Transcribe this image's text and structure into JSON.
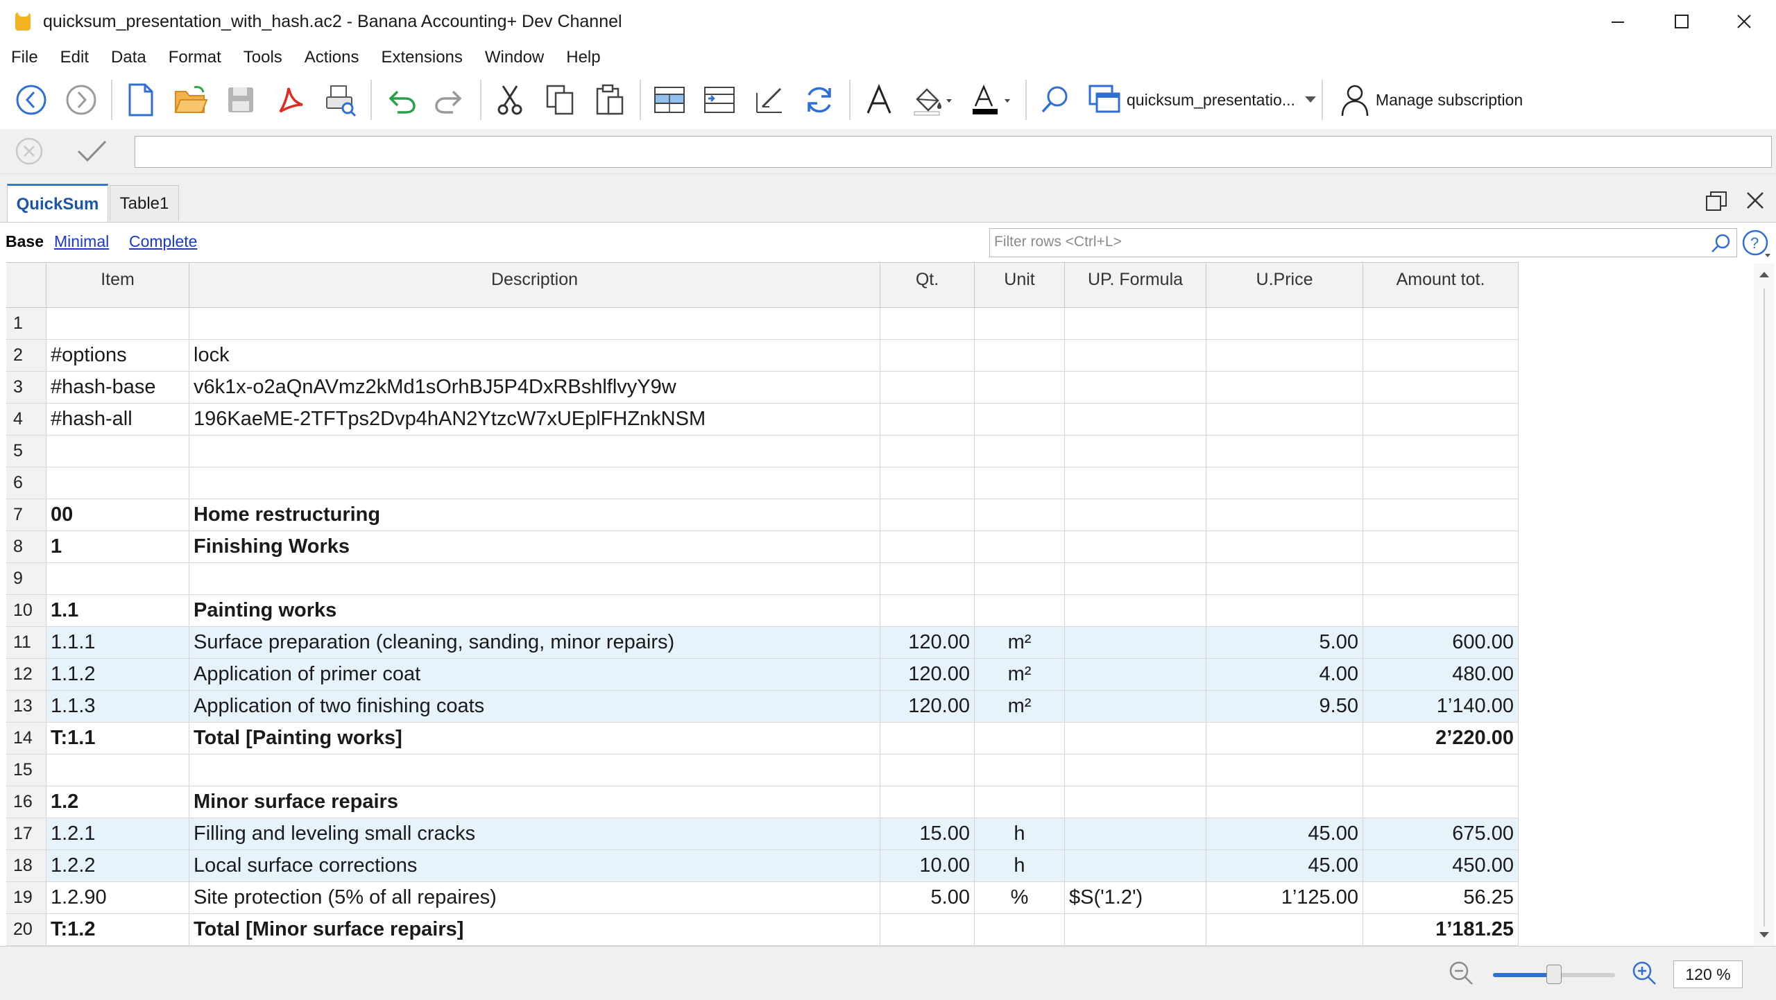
{
  "window": {
    "title": "quicksum_presentation_with_hash.ac2 - Banana Accounting+ Dev Channel"
  },
  "menu": [
    "File",
    "Edit",
    "Data",
    "Format",
    "Tools",
    "Actions",
    "Extensions",
    "Window",
    "Help"
  ],
  "toolbar": {
    "file_selector_label": "quicksum_presentatio...",
    "manage_subscription_label": "Manage subscription"
  },
  "tabs": [
    {
      "label": "QuickSum",
      "active": true
    },
    {
      "label": "Table1",
      "active": false
    }
  ],
  "views": [
    {
      "label": "Base",
      "current": true
    },
    {
      "label": "Minimal",
      "current": false
    },
    {
      "label": "Complete",
      "current": false
    }
  ],
  "filter": {
    "placeholder": "Filter rows <Ctrl+L>",
    "value": ""
  },
  "columns": [
    "Item",
    "Description",
    "Qt.",
    "Unit",
    "UP. Formula",
    "U.Price",
    "Amount tot."
  ],
  "rows": [
    {
      "n": "1",
      "item": "",
      "desc": "",
      "qt": "",
      "unit": "",
      "upf": "",
      "up": "",
      "amt": "",
      "bold": false,
      "shade": false
    },
    {
      "n": "2",
      "item": "#options",
      "desc": "lock",
      "qt": "",
      "unit": "",
      "upf": "",
      "up": "",
      "amt": "",
      "bold": false,
      "shade": false
    },
    {
      "n": "3",
      "item": "#hash-base",
      "desc": "v6k1x-o2aQnAVmz2kMd1sOrhBJ5P4DxRBshlflvyY9w",
      "qt": "",
      "unit": "",
      "upf": "",
      "up": "",
      "amt": "",
      "bold": false,
      "shade": false
    },
    {
      "n": "4",
      "item": "#hash-all",
      "desc": "196KaeME-2TFTps2Dvp4hAN2YtzcW7xUEplFHZnkNSM",
      "qt": "",
      "unit": "",
      "upf": "",
      "up": "",
      "amt": "",
      "bold": false,
      "shade": false
    },
    {
      "n": "5",
      "item": "",
      "desc": "",
      "qt": "",
      "unit": "",
      "upf": "",
      "up": "",
      "amt": "",
      "bold": false,
      "shade": false
    },
    {
      "n": "6",
      "item": "",
      "desc": "",
      "qt": "",
      "unit": "",
      "upf": "",
      "up": "",
      "amt": "",
      "bold": false,
      "shade": false
    },
    {
      "n": "7",
      "item": "00",
      "desc": "Home restructuring",
      "qt": "",
      "unit": "",
      "upf": "",
      "up": "",
      "amt": "",
      "bold": true,
      "shade": false
    },
    {
      "n": "8",
      "item": "1",
      "desc": "Finishing Works",
      "qt": "",
      "unit": "",
      "upf": "",
      "up": "",
      "amt": "",
      "bold": true,
      "shade": false
    },
    {
      "n": "9",
      "item": "",
      "desc": "",
      "qt": "",
      "unit": "",
      "upf": "",
      "up": "",
      "amt": "",
      "bold": false,
      "shade": false
    },
    {
      "n": "10",
      "item": "1.1",
      "desc": "Painting works",
      "qt": "",
      "unit": "",
      "upf": "",
      "up": "",
      "amt": "",
      "bold": true,
      "shade": false
    },
    {
      "n": "11",
      "item": "1.1.1",
      "desc": "Surface preparation (cleaning, sanding, minor repairs)",
      "qt": "120.00",
      "unit": "m²",
      "upf": "",
      "up": "5.00",
      "amt": "600.00",
      "bold": false,
      "shade": true
    },
    {
      "n": "12",
      "item": "1.1.2",
      "desc": "Application of primer coat",
      "qt": "120.00",
      "unit": "m²",
      "upf": "",
      "up": "4.00",
      "amt": "480.00",
      "bold": false,
      "shade": true
    },
    {
      "n": "13",
      "item": "1.1.3",
      "desc": "Application of two finishing coats",
      "qt": "120.00",
      "unit": "m²",
      "upf": "",
      "up": "9.50",
      "amt": "1’140.00",
      "bold": false,
      "shade": true
    },
    {
      "n": "14",
      "item": "T:1.1",
      "desc": "Total [Painting works]",
      "qt": "",
      "unit": "",
      "upf": "",
      "up": "",
      "amt": "2’220.00",
      "bold": true,
      "shade": false
    },
    {
      "n": "15",
      "item": "",
      "desc": "",
      "qt": "",
      "unit": "",
      "upf": "",
      "up": "",
      "amt": "",
      "bold": false,
      "shade": false
    },
    {
      "n": "16",
      "item": "1.2",
      "desc": "Minor surface repairs",
      "qt": "",
      "unit": "",
      "upf": "",
      "up": "",
      "amt": "",
      "bold": true,
      "shade": false
    },
    {
      "n": "17",
      "item": "1.2.1",
      "desc": "Filling and leveling small cracks",
      "qt": "15.00",
      "unit": "h",
      "upf": "",
      "up": "45.00",
      "amt": "675.00",
      "bold": false,
      "shade": true
    },
    {
      "n": "18",
      "item": "1.2.2",
      "desc": "Local surface corrections",
      "qt": "10.00",
      "unit": "h",
      "upf": "",
      "up": "45.00",
      "amt": "450.00",
      "bold": false,
      "shade": true
    },
    {
      "n": "19",
      "item": "1.2.90",
      "desc": "Site protection (5% of all repaires)",
      "qt": "5.00",
      "unit": "%",
      "upf": "$S('1.2')",
      "up": "1’125.00",
      "amt": "56.25",
      "bold": false,
      "shade": false
    },
    {
      "n": "20",
      "item": "T:1.2",
      "desc": "Total [Minor surface repairs]",
      "qt": "",
      "unit": "",
      "upf": "",
      "up": "",
      "amt": "1’181.25",
      "bold": true,
      "shade": false
    }
  ],
  "status": {
    "zoom_label": "120 %",
    "zoom_level_fraction": 0.5
  },
  "colors": {
    "shade_row": "#e6f3fb",
    "link": "#1a39c9",
    "active_tab_text": "#1c55a6"
  }
}
